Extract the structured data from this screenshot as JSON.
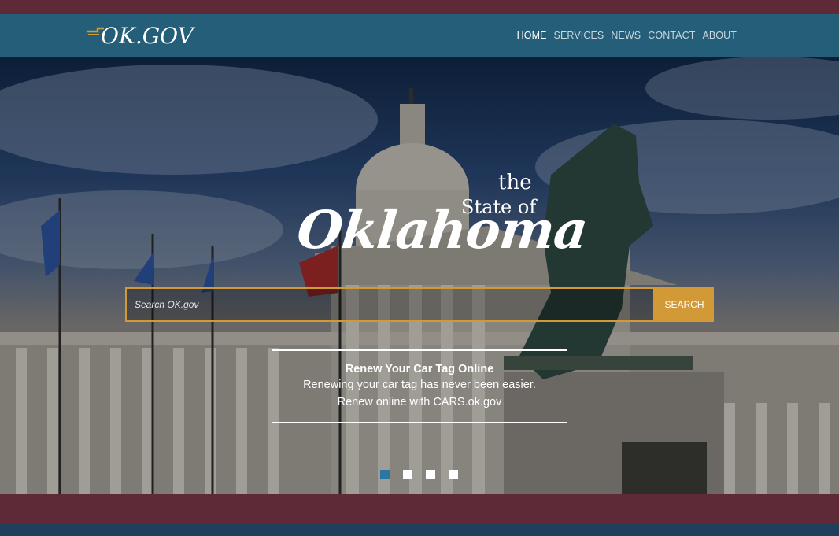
{
  "header": {
    "logo_text": "OK.GOV",
    "nav": [
      {
        "label": "HOME",
        "active": true
      },
      {
        "label": "SERVICES",
        "active": false
      },
      {
        "label": "NEWS",
        "active": false
      },
      {
        "label": "CONTACT",
        "active": false
      },
      {
        "label": "ABOUT",
        "active": false
      }
    ]
  },
  "hero": {
    "title_the": "the",
    "title_state_of": "State of",
    "title_name": "Oklahoma",
    "search": {
      "placeholder": "Search OK.gov",
      "value": "",
      "button_label": "SEARCH"
    },
    "promo": {
      "title": "Renew Your Car Tag Online",
      "line1": "Renewing your car tag has never been easier.",
      "line2": "Renew online with CARS.ok.gov"
    },
    "carousel": {
      "slide_count": 4,
      "active_slide": 1
    }
  },
  "colors": {
    "brand_maroon": "#5e2a38",
    "nav_teal": "#245e78",
    "accent_gold": "#d19a36",
    "active_dot": "#2a78a0"
  },
  "icons": [
    "ok-logo-icon"
  ]
}
